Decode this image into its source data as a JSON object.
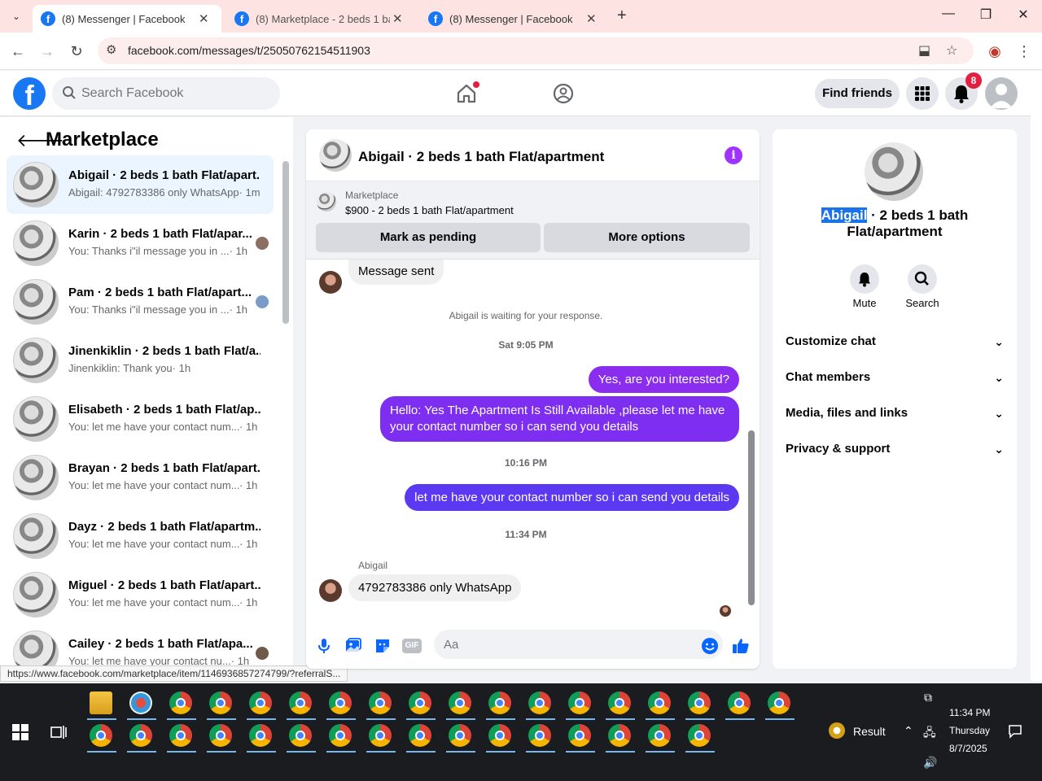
{
  "browser": {
    "tabs": [
      {
        "title": "(8) Messenger | Facebook",
        "active": true
      },
      {
        "title": "(8) Marketplace - 2 beds 1 bath",
        "active": false
      },
      {
        "title": "(8) Messenger | Facebook",
        "active": false
      }
    ],
    "url": "facebook.com/messages/t/25050762154511903",
    "status_url": "https://www.facebook.com/marketplace/item/1146936857274799/?referralS..."
  },
  "fb_header": {
    "search_placeholder": "Search Facebook",
    "find_friends": "Find friends",
    "notification_count": "8",
    "brand_color": "#1877f2"
  },
  "sidebar": {
    "title": "Marketplace",
    "conversations": [
      {
        "name": "Abigail · 2 beds 1 bath Flat/apart...",
        "preview": "Abigail: 4792783386 only WhatsApp",
        "time": "· 1m",
        "selected": true
      },
      {
        "name": "Karin · 2 beds 1 bath Flat/apar...",
        "preview": "You: Thanks i\"il message you in ...",
        "time": "· 1h"
      },
      {
        "name": "Pam · 2 beds 1 bath Flat/apart...",
        "preview": "You: Thanks i\"il message you in ...",
        "time": "· 1h"
      },
      {
        "name": "Jinenkiklin · 2 beds 1 bath Flat/a...",
        "preview": "Jinenkiklin: Thank you",
        "time": "· 1h"
      },
      {
        "name": "Elisabeth · 2 beds 1 bath Flat/ap...",
        "preview": "You: let me have your contact num...",
        "time": "· 1h"
      },
      {
        "name": "Brayan · 2 beds 1 bath Flat/apart...",
        "preview": "You: let me have your contact num...",
        "time": "· 1h"
      },
      {
        "name": "Dayz · 2 beds 1 bath Flat/apartm...",
        "preview": "You: let me have your contact num...",
        "time": "· 1h"
      },
      {
        "name": "Miguel · 2 beds 1 bath Flat/apart...",
        "preview": "You: let me have your contact num...",
        "time": "· 1h"
      },
      {
        "name": "Cailey · 2 beds 1 bath Flat/apa...",
        "preview": "You: let me have your contact nu...",
        "time": "· 1h"
      }
    ]
  },
  "chat": {
    "title": "Abigail · 2 beds 1 bath Flat/apartment",
    "marketplace_label": "Marketplace",
    "listing": "$900 - 2 beds 1 bath Flat/apartment",
    "mark_pending": "Mark as pending",
    "more_options": "More options",
    "messages": {
      "sent_note": "Message sent",
      "waiting": "Abigail is waiting for your response.",
      "time1": "Sat 9:05 PM",
      "out1": "Yes, are you interested?",
      "out2": "Hello: Yes The Apartment Is Still Available ,please let me have your contact number so i can send you details",
      "time2": "10:16 PM",
      "out3": "let me have your contact number so i can send you details",
      "time3": "11:34 PM",
      "sender": "Abigail",
      "in1": "4792783386 only WhatsApp"
    },
    "composer_placeholder": "Aa",
    "gif_label": "GIF",
    "accent_color": "#7b3ff2"
  },
  "info_panel": {
    "name_highlight": "Abigail",
    "name_rest": " · 2 beds 1 bath Flat/apartment",
    "mute": "Mute",
    "search": "Search",
    "sections": [
      "Customize chat",
      "Chat members",
      "Media, files and links",
      "Privacy & support"
    ]
  },
  "taskbar": {
    "result_label": "Result",
    "time": "11:34 PM",
    "day": "Thursday",
    "date": "8/7/2025"
  }
}
